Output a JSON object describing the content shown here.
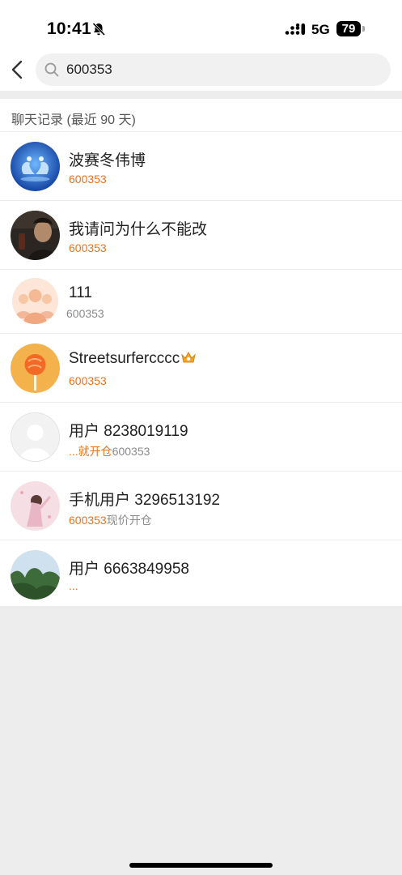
{
  "status_bar": {
    "time": "10:41",
    "network": "5G",
    "battery": "79"
  },
  "search": {
    "query": "600353"
  },
  "section": {
    "title": "聊天记录 (最近 90 天)"
  },
  "results": [
    {
      "name": "波赛冬伟博",
      "highlight": "600353",
      "extra": ""
    },
    {
      "name": "我请问为什么不能改",
      "highlight": "600353",
      "extra": ""
    },
    {
      "name": "111",
      "highlight": "600353",
      "extra": ""
    },
    {
      "name": "Streetsurfercccc",
      "highlight": "600353",
      "extra": ""
    },
    {
      "name": "用户 8238019119",
      "highlight": "...就开仓",
      "extra": "600353"
    },
    {
      "name": "手机用户 3296513192",
      "highlight": "600353",
      "extra": "现价开仓"
    },
    {
      "name": "用户 6663849958",
      "highlight": "...",
      "extra": ""
    }
  ],
  "colors": {
    "accent": "#e5731e",
    "background": "#ededed"
  }
}
